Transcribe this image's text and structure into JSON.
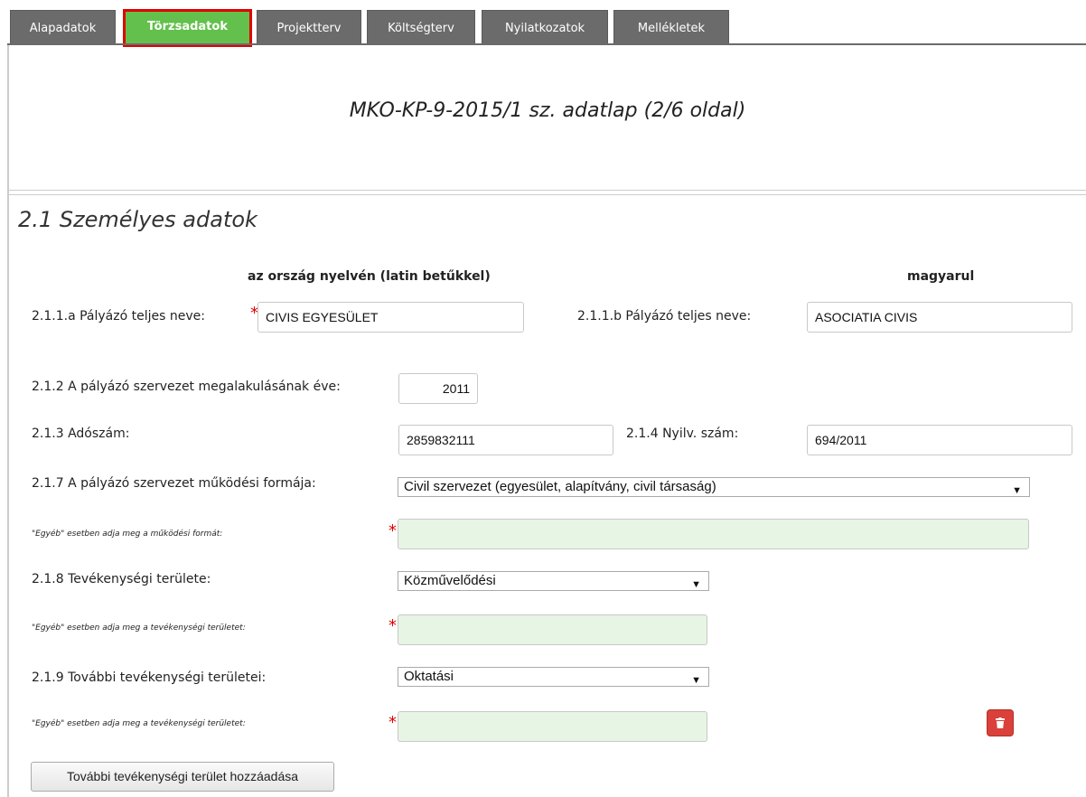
{
  "tabs": [
    {
      "label": "Alapadatok"
    },
    {
      "label": "Törzsadatok"
    },
    {
      "label": "Projektterv"
    },
    {
      "label": "Költségterv"
    },
    {
      "label": "Nyilatkozatok"
    },
    {
      "label": "Mellékletek"
    }
  ],
  "active_tab": "Törzsadatok",
  "header_title": "MKO-KP-9-2015/1 sz. adatlap (2/6 oldal)",
  "section_title": "2.1 Személyes adatok",
  "col_heads": {
    "native": "az ország nyelvén (latin betűkkel)",
    "hungarian": "magyarul"
  },
  "fields": {
    "name_native_label": "2.1.1.a Pályázó teljes neve:",
    "name_native_value": "CIVIS EGYESÜLET",
    "name_hu_label": "2.1.1.b Pályázó teljes neve:",
    "name_hu_value": "ASOCIATIA CIVIS",
    "founding_year_label": "2.1.2 A pályázó szervezet megalakulásának éve:",
    "founding_year_value": "2011",
    "tax_label": "2.1.3 Adószám:",
    "tax_value": "2859832111",
    "reg_label": "2.1.4 Nyilv. szám:",
    "reg_value": "694/2011",
    "form_label": "2.1.7 A pályázó szervezet működési formája:",
    "form_value": "Civil szervezet (egyesület, alapítvány, civil társaság)",
    "form_other_label": "\"Egyéb\" esetben adja meg a működési formát:",
    "activity_label": "2.1.8 Tevékenységi területe:",
    "activity_value": "Közművelődési",
    "activity_other_label": "\"Egyéb\" esetben adja meg a tevékenységi területet:",
    "more_activity_label": "2.1.9 További tevékenységi területei:",
    "more_activity_value": "Oktatási",
    "more_activity_other_label": "\"Egyéb\" esetben adja meg a tevékenységi területet:"
  },
  "required_mark": "*",
  "add_button_label": "További tevékenységi terület hozzáadása",
  "icons": {
    "select_arrow": "chevron-down-icon",
    "delete": "trash-icon"
  },
  "colors": {
    "tab_bg": "#6b6b6b",
    "active_tab_bg": "#63c04c",
    "active_tab_outline": "#e00000",
    "required_field_bg": "#e7f5e4",
    "delete_button": "#d9413a"
  }
}
